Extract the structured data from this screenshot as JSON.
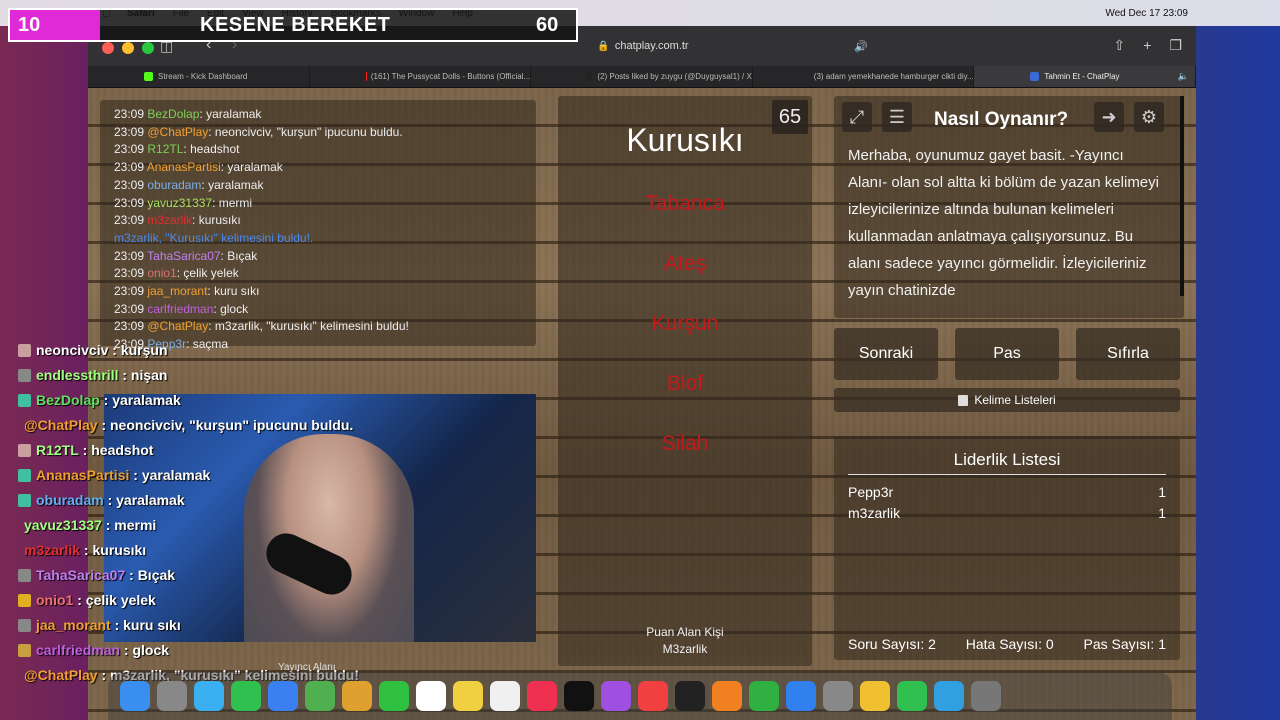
{
  "overlay": {
    "left_num": "10",
    "title": "KESENE BEREKET",
    "right_num": "60"
  },
  "menubar": {
    "apple_icon": "apple-icon",
    "items": [
      "Safari",
      "File",
      "Edit",
      "View",
      "History",
      "Bookmarks",
      "Window",
      "Help"
    ],
    "clock": "Wed Dec 17  23:09"
  },
  "browser": {
    "url": "chatplay.com.tr",
    "tabs": [
      {
        "label": "Stream - Kick Dashboard",
        "color": "#53fc18"
      },
      {
        "label": "(161) The Pussycat Dolls - Buttons (Official...",
        "color": "#ff2020"
      },
      {
        "label": "(2) Posts liked by zuygu (@Duyguysal1) / X",
        "color": "#222222"
      },
      {
        "label": "(3) adam yemekhanede hamburger cikti diy...",
        "color": "#ff2020"
      },
      {
        "label": "Tahmin Et - ChatPlay",
        "color": "#3a6ad8",
        "active": true
      }
    ]
  },
  "game_chat": [
    {
      "time": "23:09",
      "user": "BezDolap",
      "color": "#7bd05a",
      "msg": ": yaralamak"
    },
    {
      "time": "23:09",
      "user": "@ChatPlay",
      "color": "#f0a030",
      "msg": ": neoncivciv, \"kurşun\" ipucunu buldu."
    },
    {
      "time": "23:09",
      "user": "R12TL",
      "color": "#7bd05a",
      "msg": ": headshot"
    },
    {
      "time": "23:09",
      "user": "AnanasPartisi",
      "color": "#f0a030",
      "msg": ": yaralamak"
    },
    {
      "time": "23:09",
      "user": "oburadam",
      "color": "#7ab0e8",
      "msg": ": yaralamak"
    },
    {
      "time": "23:09",
      "user": "yavuz31337",
      "color": "#a8e060",
      "msg": ": mermi"
    },
    {
      "time": "23:09",
      "user": "m3zarlik",
      "color": "#e03030",
      "msg": ": kurusıkı"
    },
    {
      "time": "",
      "user": "",
      "color": "#4a8af0",
      "msg": "m3zarlik, \"Kurusıkı\" kelimesini buldu!."
    },
    {
      "time": "23:09",
      "user": "TahaSarica07",
      "color": "#c080f0",
      "msg": ": Bıçak"
    },
    {
      "time": "23:09",
      "user": "onio1",
      "color": "#e07070",
      "msg": ": çelik yelek"
    },
    {
      "time": "23:09",
      "user": "jaa_morant",
      "color": "#f0a030",
      "msg": ": kuru sıkı"
    },
    {
      "time": "23:09",
      "user": "carlfriedman",
      "color": "#c060e0",
      "msg": ": glock"
    },
    {
      "time": "23:09",
      "user": "@ChatPlay",
      "color": "#f0a030",
      "msg": ": m3zarlik, \"kurusıkı\" kelimesini buldu!"
    },
    {
      "time": "23:09",
      "user": "Pepp3r",
      "color": "#7ab0e8",
      "msg": ": saçma"
    }
  ],
  "word_card": {
    "counter": "65",
    "word": "Kurusıkı",
    "forbidden": [
      "Tabanca",
      "Ateş",
      "Kurşun",
      "Blof",
      "Silah"
    ],
    "scorer_label": "Puan Alan Kişi",
    "scorer_name": "M3zarlik"
  },
  "rules": {
    "title": "Nasıl Oynanır?",
    "text": "Merhaba, oyunumuz gayet basit. -Yayıncı Alanı- olan sol altta ki bölüm de yazan kelimeyi izleyicilerinize altında bulunan kelimeleri kullanmadan anlatmaya çalışıyorsunuz. Bu alanı sadece yayıncı görmelidir. İzleyicileriniz yayın chatinizde"
  },
  "controls": {
    "next": "Sonraki",
    "pass": "Pas",
    "reset": "Sıfırla",
    "wordlists": "Kelime Listeleri"
  },
  "leaderboard": {
    "title": "Liderlik Listesi",
    "rows": [
      {
        "name": "Pepp3r",
        "score": "1"
      },
      {
        "name": "m3zarlik",
        "score": "1"
      }
    ],
    "question_count": "Soru Sayısı: 2",
    "error_count": "Hata Sayısı: 0",
    "pass_count": "Pas Sayısı: 1"
  },
  "camera_label": "Yayıncı Alanı",
  "stream_chat": [
    {
      "user": "neoncivciv",
      "color": "#ffffff",
      "msg": " : kurşun",
      "badge": "#c8a0a0"
    },
    {
      "user": "endlessthrill",
      "color": "#a0ff80",
      "msg": " : nişan",
      "badge": "#888888"
    },
    {
      "user": "BezDolap",
      "color": "#60e060",
      "msg": " : yaralamak",
      "badge": "#40c0a0"
    },
    {
      "user": "@ChatPlay",
      "color": "#f0a030",
      "msg": " : neoncivciv, \"kurşun\" ipucunu buldu.",
      "badge": ""
    },
    {
      "user": "R12TL",
      "color": "#a0ff80",
      "msg": " : headshot",
      "badge": "#c8a0a0"
    },
    {
      "user": "AnanasPartisi",
      "color": "#f0a030",
      "msg": " : yaralamak",
      "badge": "#40c0a0"
    },
    {
      "user": "oburadam",
      "color": "#60b0f0",
      "msg": " : yaralamak",
      "badge": "#40c0a0"
    },
    {
      "user": "yavuz31337",
      "color": "#a0ff80",
      "msg": " : mermi",
      "badge": ""
    },
    {
      "user": "m3zarlik",
      "color": "#e03030",
      "msg": " : kurusıkı",
      "badge": ""
    },
    {
      "user": "TahaSarica07",
      "color": "#c080f0",
      "msg": " : Bıçak",
      "badge": "#888888"
    },
    {
      "user": "onio1",
      "color": "#f07070",
      "msg": " : çelik yelek",
      "badge": "#e0b020"
    },
    {
      "user": "jaa_morant",
      "color": "#f0a030",
      "msg": " : kuru sıkı",
      "badge": "#888888"
    },
    {
      "user": "carlfriedman",
      "color": "#c060e0",
      "msg": " : glock",
      "badge": "#c8a040"
    },
    {
      "user": "@ChatPlay",
      "color": "#f0a030",
      "msg": " : m3zarlik, \"kurusıkı\" kelimesini buldu!",
      "badge": ""
    }
  ],
  "dock_icons": [
    "finder",
    "launchpad",
    "safari",
    "messages",
    "mail",
    "maps",
    "photos",
    "facetime",
    "calendar",
    "notes",
    "reminders",
    "music",
    "tv",
    "podcasts",
    "news",
    "stocks",
    "pages",
    "numbers",
    "appstore",
    "settings",
    "chrome",
    "whatsapp",
    "telegram",
    "trash"
  ]
}
